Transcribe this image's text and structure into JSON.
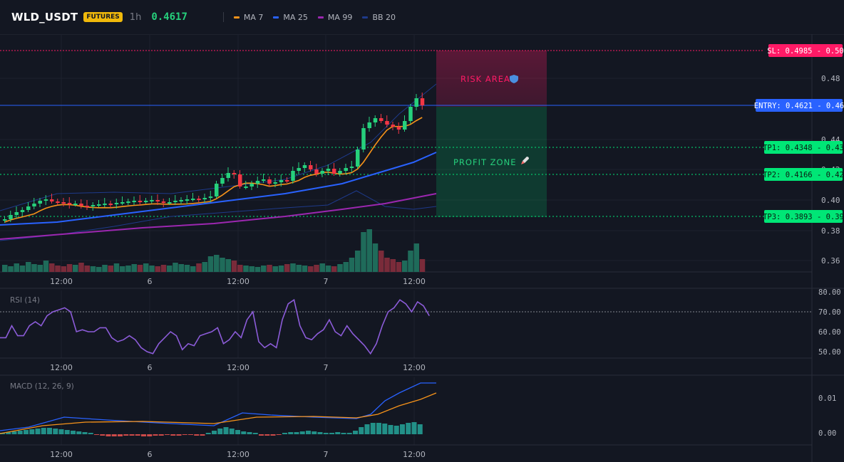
{
  "header": {
    "symbol": "WLD_USDT",
    "badge": "FUTURES",
    "timeframe": "1h",
    "last_price": "0.4617"
  },
  "indicators_legend": [
    {
      "label": "MA 7",
      "color": "#f7931a"
    },
    {
      "label": "MA 25",
      "color": "#2962ff"
    },
    {
      "label": "MA 99",
      "color": "#9c27b0"
    },
    {
      "label": "BB 20",
      "color": "#1e3a8a"
    }
  ],
  "main_chart": {
    "price_ticks": [
      "0.48",
      "0.44",
      "0.42",
      "0.40",
      "0.38",
      "0.36"
    ],
    "time_ticks": [
      "12:00",
      "6",
      "12:00",
      "7",
      "12:00"
    ],
    "levels": {
      "sl": "SL: 0.4985 - 0.50",
      "entry": "ENTRY: 0.4621 - 0.46",
      "tp1": "TP1: 0.4348 - 0.43",
      "tp2": "TP2: 0.4166 - 0.42",
      "tp3": "TP3: 0.3893 - 0.39"
    },
    "risk_label": "RISK AREA",
    "profit_label": "PROFIT ZONE",
    "colors": {
      "sl": "#ff1a66",
      "entry": "#2962ff",
      "tp": "#00e676",
      "up": "#26d07c",
      "down": "#f23645"
    }
  },
  "rsi_panel": {
    "title": "RSI (14)",
    "ticks": [
      "80.00",
      "70.00",
      "60.00",
      "50.00"
    ],
    "time_ticks": [
      "12:00",
      "6",
      "12:00",
      "7",
      "12:00"
    ]
  },
  "macd_panel": {
    "title": "MACD (12, 26, 9)",
    "ticks": [
      "0.01",
      "0.00"
    ],
    "time_ticks": [
      "12:00",
      "6",
      "12:00",
      "7",
      "12:00"
    ]
  }
}
